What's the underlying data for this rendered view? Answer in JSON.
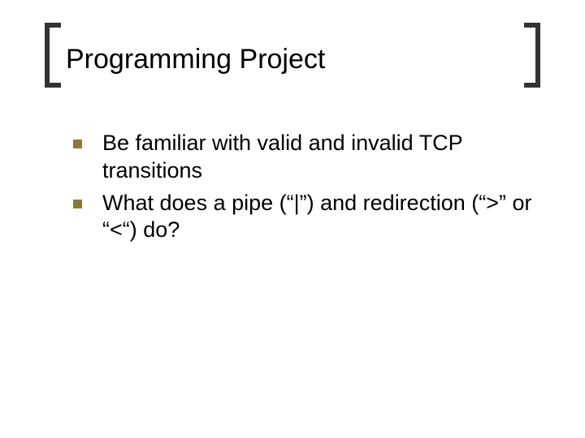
{
  "slide": {
    "title": "Programming Project",
    "bullets": [
      "Be familiar with valid and invalid TCP transitions",
      "What does a pipe (“|”) and redirection (“>” or “<“) do?"
    ]
  }
}
